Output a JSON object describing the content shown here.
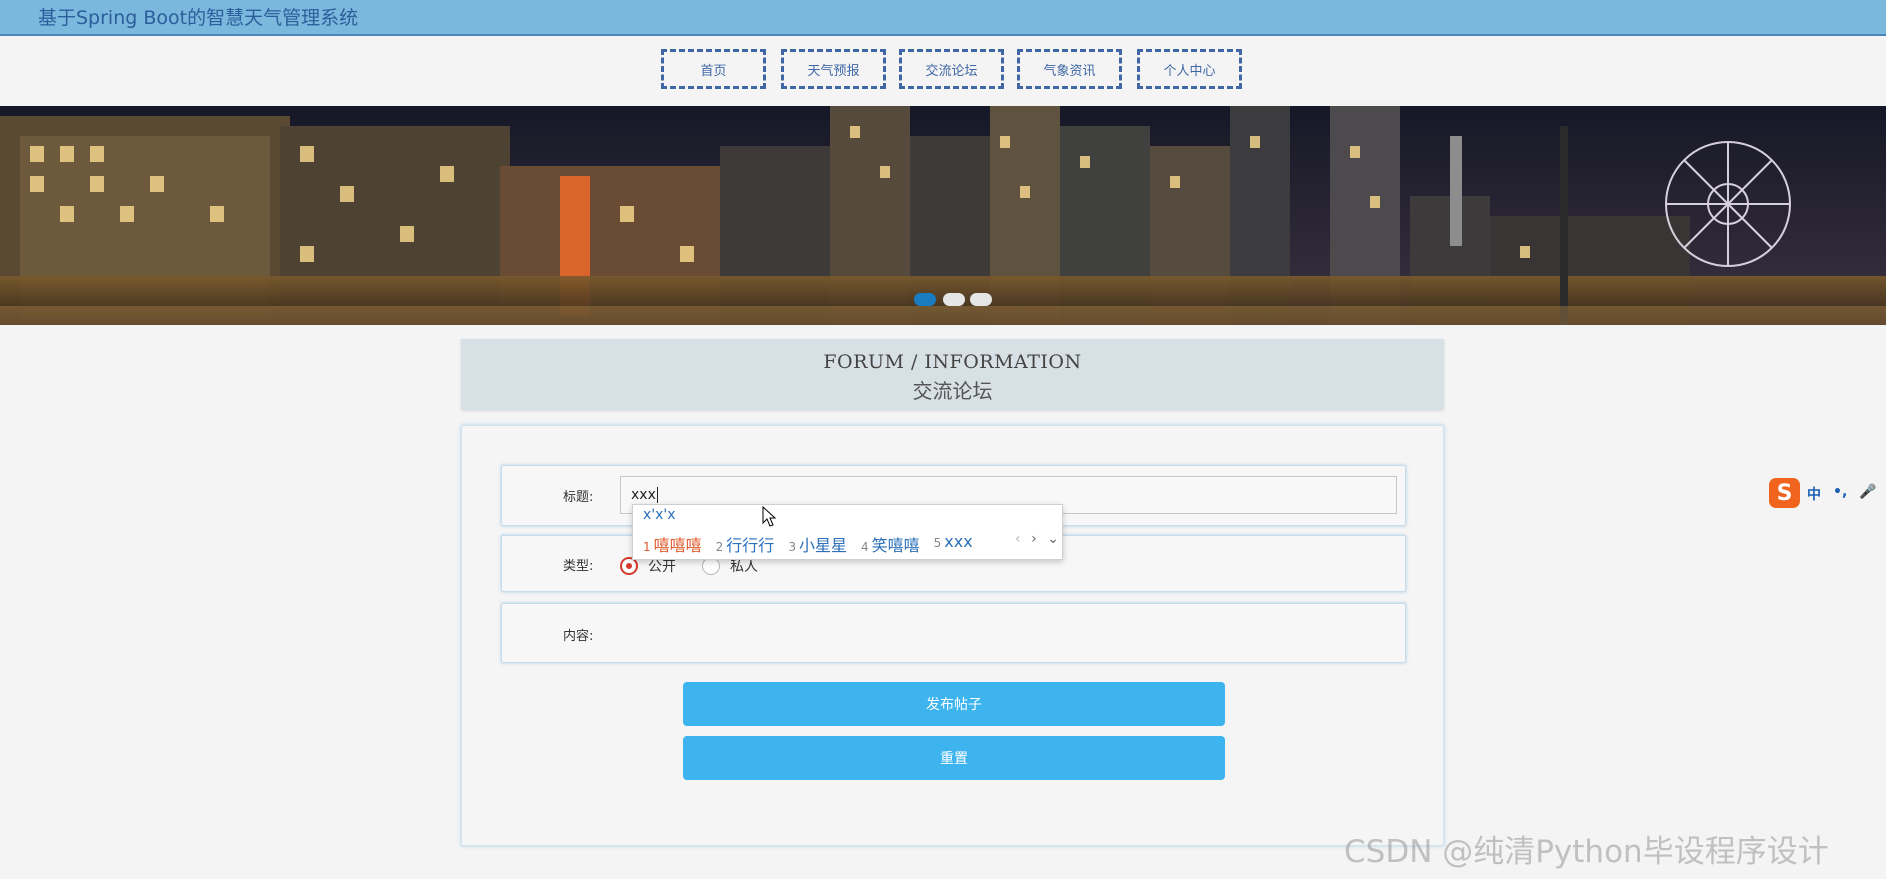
{
  "app": {
    "title": "基于Spring Boot的智慧天气管理系统"
  },
  "nav": {
    "items": [
      {
        "label": "首页"
      },
      {
        "label": "天气预报"
      },
      {
        "label": "交流论坛"
      },
      {
        "label": "气象资讯"
      },
      {
        "label": "个人中心"
      }
    ]
  },
  "carousel": {
    "slide_count": 3,
    "active_index": 0
  },
  "section": {
    "title_en": "FORUM / INFORMATION",
    "title_cn": "交流论坛"
  },
  "form": {
    "title_label": "标题:",
    "title_value": "xxx",
    "type_label": "类型:",
    "type_options": [
      {
        "label": "公开",
        "checked": true
      },
      {
        "label": "私人",
        "checked": false
      }
    ],
    "content_label": "内容:",
    "submit_label": "发布帖子",
    "reset_label": "重置"
  },
  "ime_popup": {
    "composition": "x'x'x",
    "candidates": [
      {
        "num": "1",
        "text": "嘻嘻嘻"
      },
      {
        "num": "2",
        "text": "行行行"
      },
      {
        "num": "3",
        "text": "小星星"
      },
      {
        "num": "4",
        "text": "笑嘻嘻"
      },
      {
        "num": "5",
        "text": "xxx"
      }
    ],
    "prev": "‹",
    "next": "›",
    "expand": "⌄"
  },
  "ime_toolbar": {
    "logo": "S",
    "mode": "中",
    "punct": "•,",
    "mic": "🎤",
    "grid": "⊞"
  },
  "watermark": "CSDN @纯清Python毕设程序设计",
  "colors": {
    "topbar": "#7ab9dd",
    "nav_border": "#3f67a6",
    "button": "#3db4ee",
    "radio_checked": "#d43a2b"
  }
}
